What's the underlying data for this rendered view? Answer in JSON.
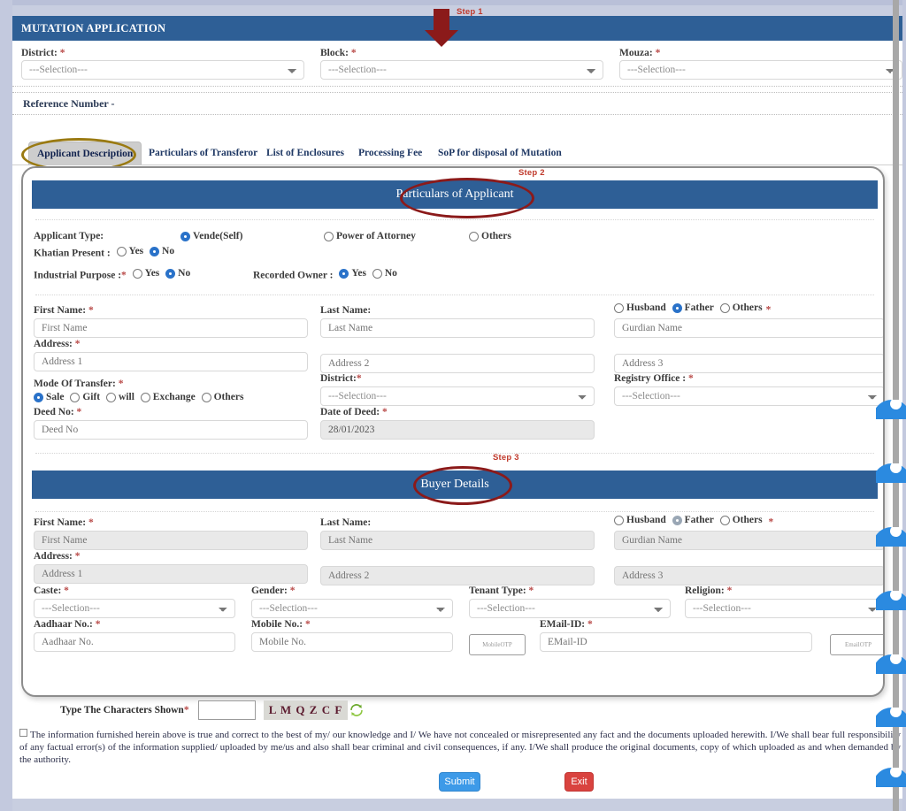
{
  "header": {
    "title": "MUTATION APPLICATION"
  },
  "top_selection": {
    "district": {
      "label": "District:",
      "required": true,
      "value": "---Selection---"
    },
    "block": {
      "label": "Block:",
      "required": true,
      "value": "---Selection---"
    },
    "mouza": {
      "label": "Mouza:",
      "required": true,
      "value": "---Selection---"
    }
  },
  "reference": {
    "label": "Reference Number -"
  },
  "tabs": [
    {
      "label": "Applicant Description",
      "active": true
    },
    {
      "label": "Particulars of Transferor",
      "active": false
    },
    {
      "label": "List of Enclosures",
      "active": false
    },
    {
      "label": "Processing Fee",
      "active": false
    },
    {
      "label": "SoP for disposal of Mutation",
      "active": false
    }
  ],
  "steps": {
    "step1": "Step 1",
    "step2": "Step 2",
    "step3": "Step 3"
  },
  "applicant_section": {
    "title": "Particulars of Applicant",
    "applicant_type": {
      "label": "Applicant Type:",
      "options": [
        "Vende(Self)",
        "Power of Attorney",
        "Others"
      ],
      "selected": "Vende(Self)"
    },
    "khatian_present": {
      "label": "Khatian Present :",
      "options": [
        "Yes",
        "No"
      ],
      "selected": "No"
    },
    "industrial_purpose": {
      "label": "Industrial Purpose :",
      "required": true,
      "options": [
        "Yes",
        "No"
      ],
      "selected": "No"
    },
    "recorded_owner": {
      "label": "Recorded Owner :",
      "options": [
        "Yes",
        "No"
      ],
      "selected": "Yes"
    },
    "first_name": {
      "label": "First Name:",
      "required": true,
      "placeholder": "First Name",
      "value": ""
    },
    "last_name": {
      "label": "Last Name:",
      "required": false,
      "placeholder": "Last Name",
      "value": ""
    },
    "guardian": {
      "options": [
        "Husband",
        "Father",
        "Others"
      ],
      "selected": "Father",
      "required": true,
      "placeholder": "Gurdian Name",
      "value": ""
    },
    "address": {
      "label": "Address:",
      "required": true,
      "line1_placeholder": "Address 1",
      "line2_placeholder": "Address 2",
      "line3_placeholder": "Address 3"
    },
    "mode_of_transfer": {
      "label": "Mode Of Transfer:",
      "required": true,
      "options": [
        "Sale",
        "Gift",
        "will",
        "Exchange",
        "Others"
      ],
      "selected": "Sale"
    },
    "district": {
      "label": "District:",
      "required": true,
      "value": "---Selection---"
    },
    "registry_office": {
      "label": "Registry Office :",
      "required": true,
      "value": "---Selection---"
    },
    "deed_no": {
      "label": "Deed No:",
      "required": true,
      "placeholder": "Deed No",
      "value": ""
    },
    "date_of_deed": {
      "label": "Date of Deed:",
      "required": true,
      "value": "28/01/2023",
      "disabled": true
    }
  },
  "buyer_section": {
    "title": "Buyer Details",
    "first_name": {
      "label": "First Name:",
      "required": true,
      "placeholder": "First Name",
      "value": ""
    },
    "last_name": {
      "label": "Last Name:",
      "required": false,
      "placeholder": "Last Name",
      "value": ""
    },
    "guardian": {
      "options": [
        "Husband",
        "Father",
        "Others"
      ],
      "selected": "Father",
      "required": true,
      "placeholder": "Gurdian Name",
      "value": ""
    },
    "address": {
      "label": "Address:",
      "required": true,
      "line1_placeholder": "Address 1",
      "line2_placeholder": "Address 2",
      "line3_placeholder": "Address 3"
    },
    "caste": {
      "label": "Caste:",
      "required": true,
      "value": "---Selection---"
    },
    "gender": {
      "label": "Gender:",
      "required": true,
      "value": "---Selection---"
    },
    "tenant_type": {
      "label": "Tenant Type:",
      "required": true,
      "value": "---Selection---"
    },
    "religion": {
      "label": "Religion:",
      "required": true,
      "value": "---Selection---"
    },
    "aadhaar": {
      "label": "Aadhaar No.:",
      "required": true,
      "placeholder": "Aadhaar No.",
      "value": ""
    },
    "mobile": {
      "label": "Mobile No.:",
      "required": true,
      "placeholder": "Mobile No.",
      "value": ""
    },
    "mobile_otp_button": "MobileOTP",
    "email": {
      "label": "EMail-ID:",
      "required": true,
      "placeholder": "EMail-ID",
      "value": ""
    },
    "email_otp_button": "EmailOTP"
  },
  "captcha": {
    "label": "Type The Characters Shown",
    "required": true,
    "value": "",
    "image_text": "L M  Q Z C F",
    "refresh_icon": "refresh-icon"
  },
  "declaration": {
    "checked": false,
    "text": "The information furnished herein above is true and correct to the best of my/ our knowledge and I/ We have not concealed or misrepresented any fact and the documents uploaded herewith. I/We shall bear full responsibility of any factual error(s) of the information supplied/ uploaded by me/us and also shall bear criminal and civil consequences, if any. I/We shall produce the original documents, copy of which uploaded as and when demanded by the authority."
  },
  "actions": {
    "submit": "Submit",
    "exit": "Exit"
  },
  "colors": {
    "header_blue": "#2e5f96",
    "accent_blue": "#2a72c9",
    "required_red": "#b94a48",
    "annotation_red": "#c0392b",
    "ellipse_red": "#8b1a1a",
    "ellipse_gold": "#9a7a12",
    "submit_blue": "#3d9ae8",
    "exit_red": "#d9433f",
    "page_gutter": "#c3c9de",
    "blob_blue": "#2b8ae0"
  }
}
